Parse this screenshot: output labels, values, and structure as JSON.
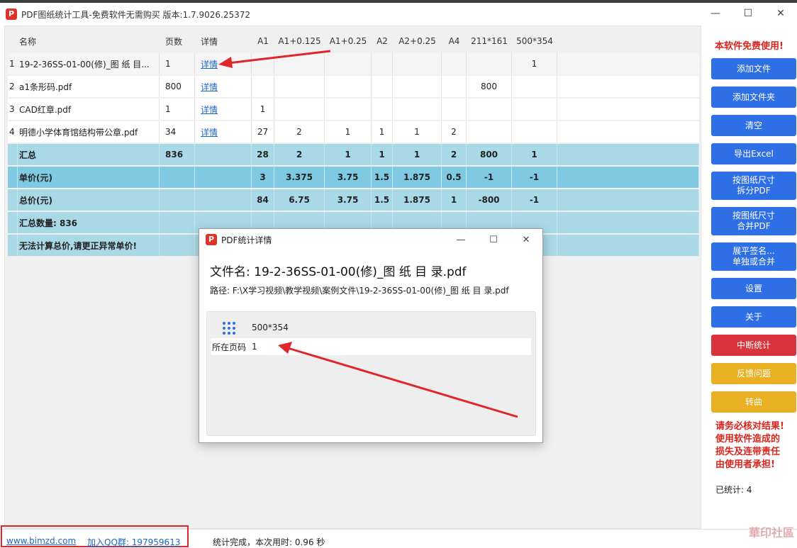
{
  "window": {
    "title": "PDF图纸统计工具-免费软件无需购买 版本:1.7.9026.25372",
    "icon_label": "P",
    "minimize": "—",
    "maximize": "☐",
    "close": "✕"
  },
  "table": {
    "headers": [
      "名称",
      "页数",
      "详情",
      "A1",
      "A1+0.125",
      "A1+0.25",
      "A2",
      "A2+0.25",
      "A4",
      "211*161",
      "500*354"
    ],
    "rows": [
      {
        "index": "1",
        "name": "19-2-36SS-01-00(修)_图 纸 目...",
        "pages": "1",
        "detail": "详情",
        "a1": "",
        "a1p0125": "",
        "a1p025": "",
        "a2": "",
        "a2p025": "",
        "a4": "",
        "s211": "",
        "s500": "1"
      },
      {
        "index": "2",
        "name": "a1条形码.pdf",
        "pages": "800",
        "detail": "详情",
        "a1": "",
        "a1p0125": "",
        "a1p025": "",
        "a2": "",
        "a2p025": "",
        "a4": "",
        "s211": "800",
        "s500": ""
      },
      {
        "index": "3",
        "name": "CAD红章.pdf",
        "pages": "1",
        "detail": "详情",
        "a1": "1",
        "a1p0125": "",
        "a1p025": "",
        "a2": "",
        "a2p025": "",
        "a4": "",
        "s211": "",
        "s500": ""
      },
      {
        "index": "4",
        "name": "明德小学体育馆结构带公章.pdf",
        "pages": "34",
        "detail": "详情",
        "a1": "27",
        "a1p0125": "2",
        "a1p025": "1",
        "a2": "1",
        "a2p025": "1",
        "a4": "2",
        "s211": "",
        "s500": ""
      }
    ],
    "summary": {
      "label": "汇总",
      "pages": "836",
      "a1": "28",
      "a1p0125": "2",
      "a1p025": "1",
      "a2": "1",
      "a2p025": "1",
      "a4": "2",
      "s211": "800",
      "s500": "1"
    },
    "unit_price": {
      "label": "单价(元)",
      "a1": "3",
      "a1p0125": "3.375",
      "a1p025": "3.75",
      "a2": "1.5",
      "a2p025": "1.875",
      "a4": "0.5",
      "s211": "-1",
      "s500": "-1"
    },
    "total_price": {
      "label": "总价(元)",
      "a1": "84",
      "a1p0125": "6.75",
      "a1p025": "3.75",
      "a2": "1.5",
      "a2p025": "1.875",
      "a4": "1",
      "s211": "-800",
      "s500": "-1"
    },
    "total_count": {
      "label": "汇总数量: 836"
    },
    "warning": {
      "label": "无法计算总价,请更正异常单价!"
    }
  },
  "sidebar": {
    "notice_top": "本软件免费使用!",
    "buttons": {
      "add_file": "添加文件",
      "add_folder": "添加文件夹",
      "clear": "清空",
      "export_excel": "导出Excel",
      "split_pdf_line1": "按图纸尺寸",
      "split_pdf_line2": "拆分PDF",
      "merge_pdf_line1": "按图纸尺寸",
      "merge_pdf_line2": "合并PDF",
      "flatten_line1": "展平签名...",
      "flatten_line2": "单独或合并",
      "settings": "设置",
      "about": "关于",
      "interrupt": "中断统计",
      "feedback": "反馈问题",
      "convert": "转曲"
    },
    "notice_bottom": [
      "请务必核对结果!",
      "使用软件造成的",
      "损失及连带责任",
      "由使用者承担!"
    ],
    "counted": "已统计: 4"
  },
  "statusbar": {
    "website": "www.bimzd.com",
    "qq_group": "加入QQ群: 197959613",
    "status": "统计完成，本次用时: 0.96 秒",
    "watermark": "華印社區"
  },
  "dialog": {
    "title": "PDF统计详情",
    "file_name": "文件名: 19-2-36SS-01-00(修)_图 纸 目 录.pdf",
    "path": "路径:  F:\\X学习视频\\教学视频\\案例文件\\19-2-36SS-01-00(修)_图 纸 目 录.pdf",
    "size": "500*354",
    "page_label": "所在页码",
    "page_value": "1"
  },
  "colors": {
    "accent_blue": "#2f6fe6",
    "danger_red": "#d9343b",
    "warn_yellow": "#e9b023",
    "summary_row": "#a9d9e6",
    "price_row": "#7fc9e2",
    "annotation_red": "#e0262a"
  }
}
